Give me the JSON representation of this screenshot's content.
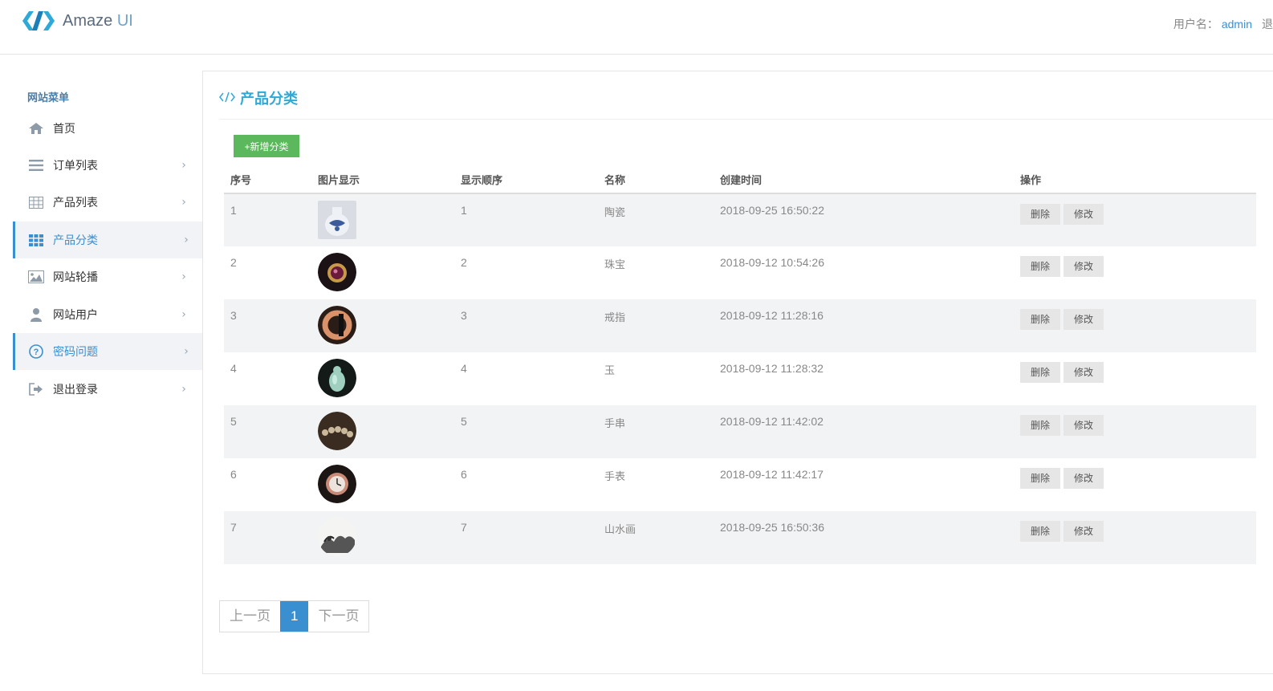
{
  "header": {
    "logo_text": "Amaze",
    "logo_ui": "UI",
    "user_label": "用户名：",
    "username": "admin",
    "logout": "退"
  },
  "sidebar": {
    "title": "网站菜单",
    "items": [
      {
        "label": "首页",
        "icon": "home-icon"
      },
      {
        "label": "订单列表",
        "icon": "list-icon"
      },
      {
        "label": "产品列表",
        "icon": "table-icon"
      },
      {
        "label": "产品分类",
        "icon": "grid-icon",
        "active": true
      },
      {
        "label": "网站轮播",
        "icon": "image-icon"
      },
      {
        "label": "网站用户",
        "icon": "user-icon"
      },
      {
        "label": "密码问题",
        "icon": "question-icon",
        "active": true
      },
      {
        "label": "退出登录",
        "icon": "sign-out-icon"
      }
    ]
  },
  "main": {
    "title": "产品分类",
    "add_button": "+新增分类",
    "columns": [
      "序号",
      "图片显示",
      "显示顺序",
      "名称",
      "创建时间",
      "操作"
    ],
    "rows": [
      {
        "id": "1",
        "order": "1",
        "name": "陶瓷",
        "created": "2018-09-25 16:50:22"
      },
      {
        "id": "2",
        "order": "2",
        "name": "珠宝",
        "created": "2018-09-12 10:54:26"
      },
      {
        "id": "3",
        "order": "3",
        "name": "戒指",
        "created": "2018-09-12 11:28:16"
      },
      {
        "id": "4",
        "order": "4",
        "name": "玉",
        "created": "2018-09-12 11:28:32"
      },
      {
        "id": "5",
        "order": "5",
        "name": "手串",
        "created": "2018-09-12 11:42:02"
      },
      {
        "id": "6",
        "order": "6",
        "name": "手表",
        "created": "2018-09-12 11:42:17"
      },
      {
        "id": "7",
        "order": "7",
        "name": "山水画",
        "created": "2018-09-25 16:50:36"
      }
    ],
    "delete_label": "删除",
    "edit_label": "修改"
  },
  "pager": {
    "prev": "上一页",
    "current": "1",
    "next": "下一页"
  },
  "colors": {
    "accent": "#3a8fd1",
    "title": "#2fa9d8",
    "add_button": "#5cb85c"
  }
}
